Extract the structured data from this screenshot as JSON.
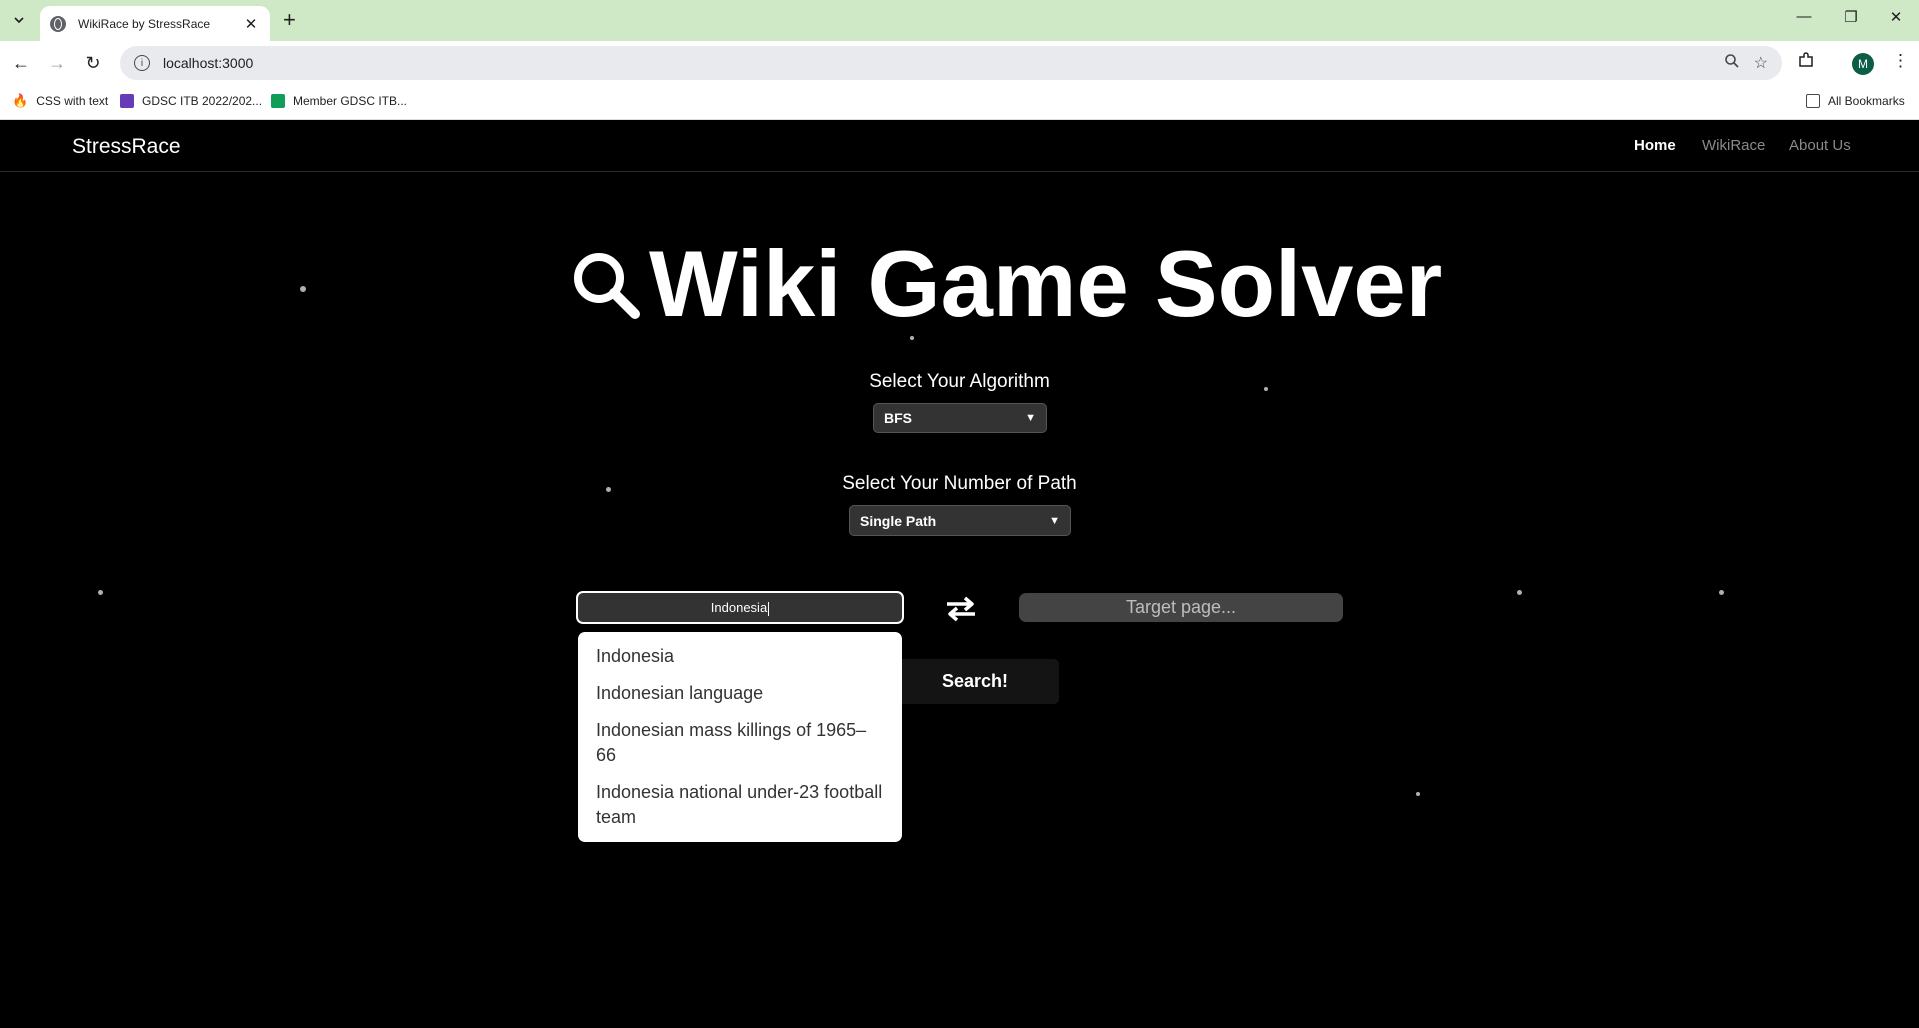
{
  "browser": {
    "tab_title": "WikiRace by StressRace",
    "url": "localhost:3000",
    "bookmarks": [
      "CSS with text",
      "GDSC ITB 2022/202...",
      "Member GDSC ITB..."
    ],
    "all_bookmarks": "All Bookmarks",
    "profile_initial": "M"
  },
  "navbar": {
    "brand": "StressRace",
    "links": [
      "Home",
      "WikiRace",
      "About Us"
    ],
    "active": "Home"
  },
  "hero": {
    "title": "Wiki Game Solver"
  },
  "algorithm": {
    "label": "Select Your Algorithm",
    "selected": "BFS"
  },
  "path": {
    "label": "Select Your Number of Path",
    "selected": "Single Path"
  },
  "source": {
    "value": "Indonesia"
  },
  "target": {
    "placeholder": "Target page..."
  },
  "search_button": "Search!",
  "suggestions": [
    "Indonesia",
    "Indonesian language",
    "Indonesian mass killings of 1965–66",
    "Indonesia national under-23 football team"
  ],
  "colors": {
    "background": "#000000",
    "tabstrip": "#cfe8c6",
    "input": "#333333"
  }
}
